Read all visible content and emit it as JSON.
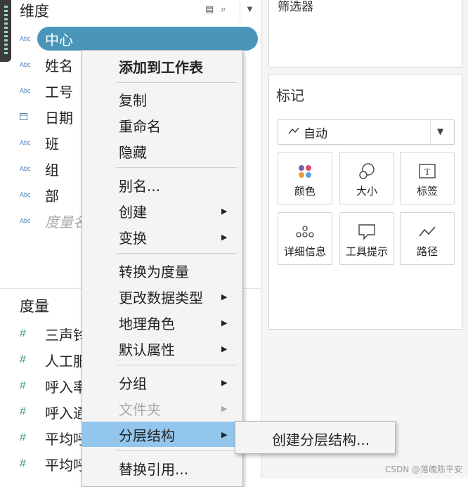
{
  "dimensions_section": {
    "title": "维度",
    "fields": [
      {
        "type_icon": "Abc",
        "name": "中心"
      },
      {
        "type_icon": "Abc",
        "name": "姓名"
      },
      {
        "type_icon": "Abc",
        "name": "工号"
      },
      {
        "type_icon": "calendar-icon",
        "name": "日期"
      },
      {
        "type_icon": "Abc",
        "name": "班"
      },
      {
        "type_icon": "Abc",
        "name": "组"
      },
      {
        "type_icon": "Abc",
        "name": "部"
      },
      {
        "type_icon": "Abc",
        "name": "度量名"
      }
    ]
  },
  "measures_section": {
    "title": "度量",
    "fields": [
      {
        "type_icon": "#",
        "name": "三声铃"
      },
      {
        "type_icon": "#",
        "name": "人工服"
      },
      {
        "type_icon": "#",
        "name": "呼入率"
      },
      {
        "type_icon": "#",
        "name": "呼入通"
      },
      {
        "type_icon": "#",
        "name": "平均呼"
      },
      {
        "type_icon": "#",
        "name": "平均呼"
      }
    ]
  },
  "filters_card": {
    "label": "筛选器"
  },
  "marks_card": {
    "label": "标记",
    "mark_type": "自动",
    "buttons": [
      {
        "label": "颜色",
        "icon": "color-icon"
      },
      {
        "label": "大小",
        "icon": "size-icon"
      },
      {
        "label": "标签",
        "icon": "label-icon"
      },
      {
        "label": "详细信息",
        "icon": "detail-icon"
      },
      {
        "label": "工具提示",
        "icon": "tooltip-icon"
      },
      {
        "label": "路径",
        "icon": "path-icon"
      }
    ]
  },
  "context_menu": {
    "items": [
      {
        "label": "添加到工作表",
        "bold": true
      },
      {
        "label": "复制"
      },
      {
        "label": "重命名"
      },
      {
        "label": "隐藏"
      },
      {
        "label": "别名..."
      },
      {
        "label": "创建",
        "submenu": true
      },
      {
        "label": "变换",
        "submenu": true
      },
      {
        "label": "转换为度量"
      },
      {
        "label": "更改数据类型",
        "submenu": true
      },
      {
        "label": "地理角色",
        "submenu": true
      },
      {
        "label": "默认属性",
        "submenu": true
      },
      {
        "label": "分组",
        "submenu": true
      },
      {
        "label": "文件夹",
        "submenu": true,
        "disabled": true
      },
      {
        "label": "分层结构",
        "submenu": true,
        "highlighted": true
      },
      {
        "label": "替换引用..."
      }
    ],
    "submenu_item": "创建分层结构..."
  },
  "watermark": "CSDN @落魄陈平安",
  "colors": {
    "selected_pill": "#4a96b8",
    "menu_highlight": "#92c6ec",
    "measure_icon": "#3a9e74",
    "dimension_icon": "#4d7fb1"
  }
}
